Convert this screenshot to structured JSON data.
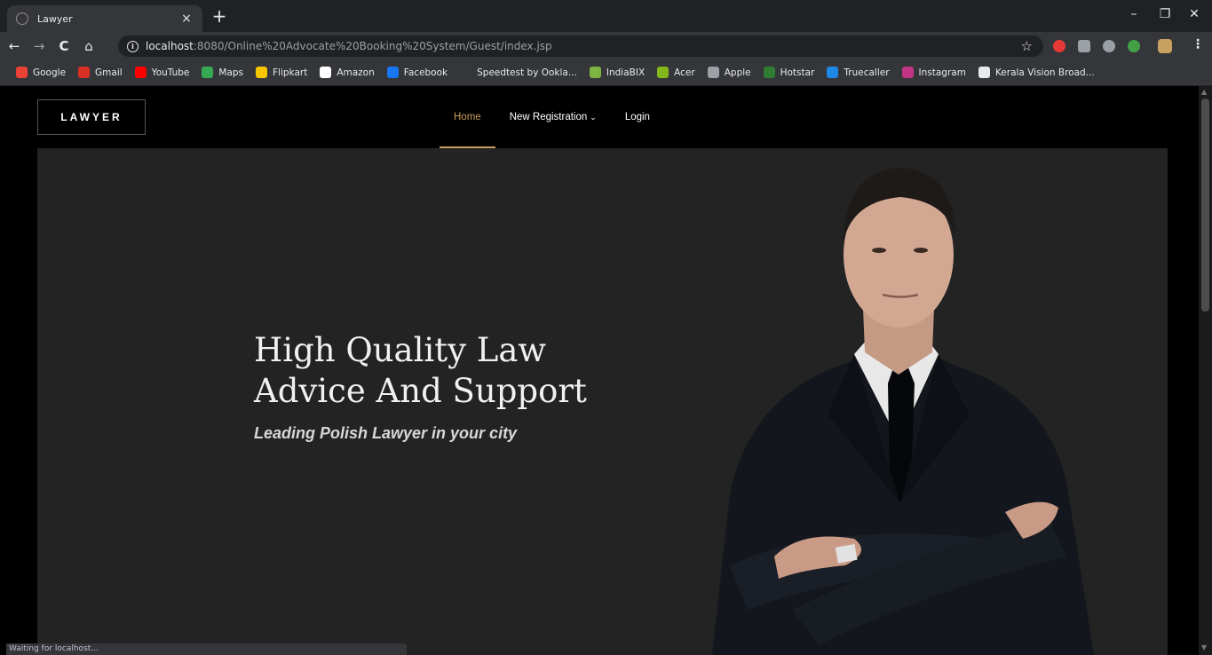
{
  "browser": {
    "tab_title": "Lawyer",
    "tab_close": "×",
    "new_tab": "+",
    "win_min": "–",
    "win_restore": "❐",
    "win_close": "✕",
    "url_host": "localhost",
    "url_rest": ":8080/Online%20Advocate%20Booking%20System/Guest/index.jsp",
    "back": "←",
    "forward": "→",
    "reload": "C",
    "home": "⌂",
    "star": "☆",
    "menu": "⋮",
    "status": "Waiting for localhost..."
  },
  "bookmarks": [
    {
      "label": "Google",
      "icon": "google-icon",
      "color": "#ea4335"
    },
    {
      "label": "Gmail",
      "icon": "gmail-icon",
      "color": "#d93025"
    },
    {
      "label": "YouTube",
      "icon": "youtube-icon",
      "color": "#ff0000"
    },
    {
      "label": "Maps",
      "icon": "maps-icon",
      "color": "#34a853"
    },
    {
      "label": "Flipkart",
      "icon": "flipkart-icon",
      "color": "#f7c600"
    },
    {
      "label": "Amazon",
      "icon": "amazon-icon",
      "color": "#ffffff"
    },
    {
      "label": "Facebook",
      "icon": "facebook-icon",
      "color": "#1877f2"
    },
    {
      "label": "Speedtest by Ookla...",
      "icon": "speedtest-icon",
      "color": "#35363a"
    },
    {
      "label": "IndiaBIX",
      "icon": "indiabix-icon",
      "color": "#7cb342"
    },
    {
      "label": "Acer",
      "icon": "acer-icon",
      "color": "#83b81a"
    },
    {
      "label": "Apple",
      "icon": "apple-icon",
      "color": "#9aa0a6"
    },
    {
      "label": "Hotstar",
      "icon": "hotstar-icon",
      "color": "#2e7d32"
    },
    {
      "label": "Truecaller",
      "icon": "truecaller-icon",
      "color": "#1e88e5"
    },
    {
      "label": "Instagram",
      "icon": "instagram-icon",
      "color": "#c13584"
    },
    {
      "label": "Kerala Vision Broad...",
      "icon": "keralavision-icon",
      "color": "#e8eaed"
    }
  ],
  "site": {
    "logo": "LAWYER",
    "nav": {
      "home": "Home",
      "new_registration": "New Registration",
      "login": "Login"
    },
    "hero": {
      "title_line1": "High Quality Law",
      "title_line2": "Advice And Support",
      "subtitle": "Leading Polish Lawyer in your city"
    }
  },
  "colors": {
    "accent": "#c89c5c",
    "hero_bg": "#232323"
  }
}
